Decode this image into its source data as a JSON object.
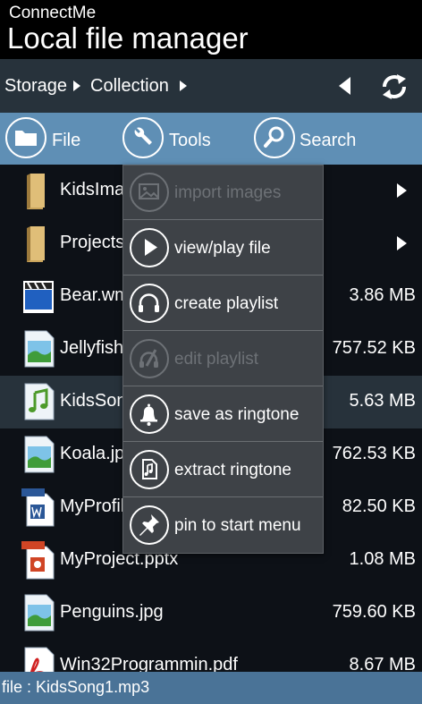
{
  "header": {
    "app_name": "ConnectMe",
    "page_title": "Local file manager"
  },
  "breadcrumb": {
    "items": [
      "Storage",
      "Collection"
    ]
  },
  "toolbar": {
    "file_label": "File",
    "tools_label": "Tools",
    "search_label": "Search"
  },
  "files": [
    {
      "name": "KidsImages",
      "size": "",
      "icon": "folder-icon",
      "has_children": true
    },
    {
      "name": "Projects",
      "size": "",
      "icon": "folder-icon",
      "has_children": true
    },
    {
      "name": "Bear.wmv",
      "size": "3.86 MB",
      "icon": "video-file-icon"
    },
    {
      "name": "Jellyfish.jpg",
      "size": "757.52 KB",
      "icon": "image-file-icon"
    },
    {
      "name": "KidsSong1.mp3",
      "size": "5.63 MB",
      "icon": "music-file-icon",
      "selected": true
    },
    {
      "name": "Koala.jpg",
      "size": "762.53 KB",
      "icon": "image-file-icon"
    },
    {
      "name": "MyProfile.docx",
      "size": "82.50 KB",
      "icon": "docx-file-icon"
    },
    {
      "name": "MyProject.pptx",
      "size": "1.08 MB",
      "icon": "pptx-file-icon"
    },
    {
      "name": "Penguins.jpg",
      "size": "759.60 KB",
      "icon": "image-file-icon"
    },
    {
      "name": "Win32Programmin.pdf",
      "size": "8.67 MB",
      "icon": "pdf-file-icon"
    }
  ],
  "context_menu": {
    "items": [
      {
        "label": "import images",
        "icon": "image-icon",
        "enabled": false
      },
      {
        "label": "view/play file",
        "icon": "play-icon",
        "enabled": true
      },
      {
        "label": "create playlist",
        "icon": "headphones-icon",
        "enabled": true
      },
      {
        "label": "edit playlist",
        "icon": "edit-playlist-icon",
        "enabled": false
      },
      {
        "label": "save as ringtone",
        "icon": "bell-icon",
        "enabled": true
      },
      {
        "label": "extract ringtone",
        "icon": "extract-document-icon",
        "enabled": true
      },
      {
        "label": "pin to start menu",
        "icon": "pin-icon",
        "enabled": true
      }
    ]
  },
  "status": {
    "text": "file : KidsSong1.mp3"
  },
  "colors": {
    "toolbar": "#5f8fb5",
    "statusbar": "#4a7397",
    "breadcrumb_bar": "#27323b",
    "menu_background": "#3e4247",
    "list_background": "#0d1117"
  }
}
